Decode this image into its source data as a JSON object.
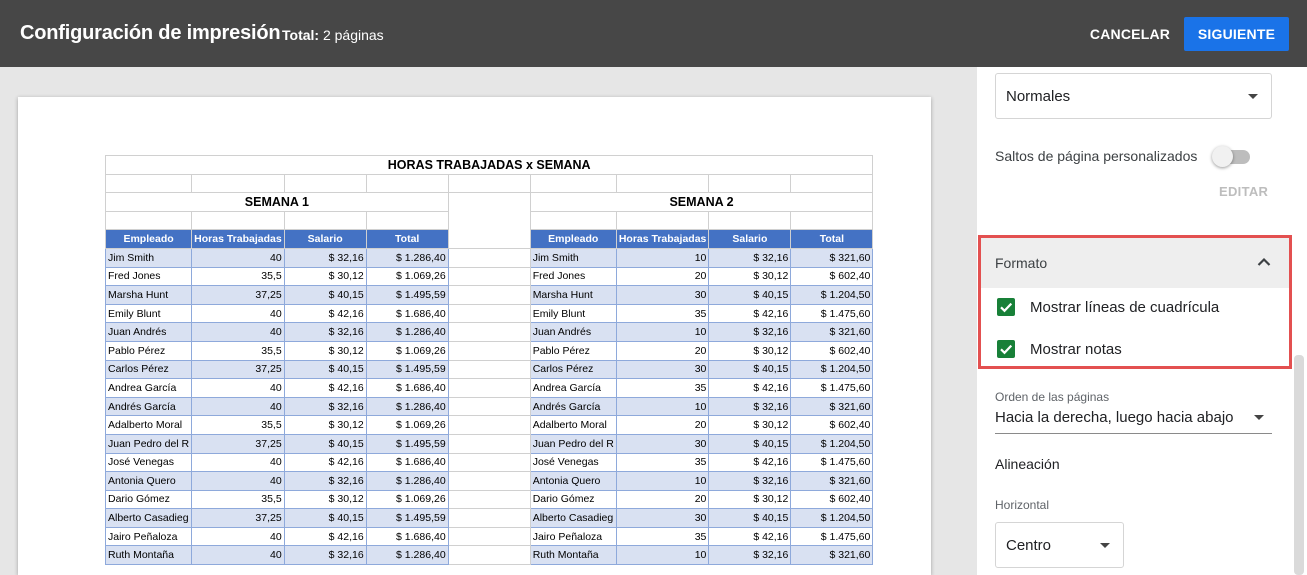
{
  "topbar": {
    "title": "Configuración de impresión",
    "total_label": "Total:",
    "total_value": "2 páginas",
    "cancel": "CANCELAR",
    "next": "SIGUIENTE"
  },
  "sheet": {
    "title": "HORAS TRABAJADAS x SEMANA",
    "week1": "SEMANA 1",
    "week2": "SEMANA 2",
    "headers": [
      "Empleado",
      "Horas Trabajadas",
      "Salario",
      "Total"
    ],
    "week1_rows": [
      [
        "Jim Smith",
        "40",
        "$ 32,16",
        "$ 1.286,40"
      ],
      [
        "Fred Jones",
        "35,5",
        "$ 30,12",
        "$ 1.069,26"
      ],
      [
        "Marsha Hunt",
        "37,25",
        "$ 40,15",
        "$ 1.495,59"
      ],
      [
        "Emily Blunt",
        "40",
        "$ 42,16",
        "$ 1.686,40"
      ],
      [
        "Juan Andrés",
        "40",
        "$ 32,16",
        "$ 1.286,40"
      ],
      [
        "Pablo Pérez",
        "35,5",
        "$ 30,12",
        "$ 1.069,26"
      ],
      [
        "Carlos Pérez",
        "37,25",
        "$ 40,15",
        "$ 1.495,59"
      ],
      [
        "Andrea García",
        "40",
        "$ 42,16",
        "$ 1.686,40"
      ],
      [
        "Andrés García",
        "40",
        "$ 32,16",
        "$ 1.286,40"
      ],
      [
        "Adalberto Moral",
        "35,5",
        "$ 30,12",
        "$ 1.069,26"
      ],
      [
        "Juan Pedro del R",
        "37,25",
        "$ 40,15",
        "$ 1.495,59"
      ],
      [
        "José Venegas",
        "40",
        "$ 42,16",
        "$ 1.686,40"
      ],
      [
        "Antonia Quero",
        "40",
        "$ 32,16",
        "$ 1.286,40"
      ],
      [
        "Dario Gómez",
        "35,5",
        "$ 30,12",
        "$ 1.069,26"
      ],
      [
        "Alberto Casadieg",
        "37,25",
        "$ 40,15",
        "$ 1.495,59"
      ],
      [
        "Jairo Peñaloza",
        "40",
        "$ 42,16",
        "$ 1.686,40"
      ],
      [
        "Ruth Montaña",
        "40",
        "$ 32,16",
        "$ 1.286,40"
      ]
    ],
    "week2_rows": [
      [
        "Jim Smith",
        "10",
        "$ 32,16",
        "$ 321,60"
      ],
      [
        "Fred Jones",
        "20",
        "$ 30,12",
        "$ 602,40"
      ],
      [
        "Marsha Hunt",
        "30",
        "$ 40,15",
        "$ 1.204,50"
      ],
      [
        "Emily Blunt",
        "35",
        "$ 42,16",
        "$ 1.475,60"
      ],
      [
        "Juan Andrés",
        "10",
        "$ 32,16",
        "$ 321,60"
      ],
      [
        "Pablo Pérez",
        "20",
        "$ 30,12",
        "$ 602,40"
      ],
      [
        "Carlos Pérez",
        "30",
        "$ 40,15",
        "$ 1.204,50"
      ],
      [
        "Andrea García",
        "35",
        "$ 42,16",
        "$ 1.475,60"
      ],
      [
        "Andrés García",
        "10",
        "$ 32,16",
        "$ 321,60"
      ],
      [
        "Adalberto Moral",
        "20",
        "$ 30,12",
        "$ 602,40"
      ],
      [
        "Juan Pedro del R",
        "30",
        "$ 40,15",
        "$ 1.204,50"
      ],
      [
        "José Venegas",
        "35",
        "$ 42,16",
        "$ 1.475,60"
      ],
      [
        "Antonia Quero",
        "10",
        "$ 32,16",
        "$ 321,60"
      ],
      [
        "Dario Gómez",
        "20",
        "$ 30,12",
        "$ 602,40"
      ],
      [
        "Alberto Casadieg",
        "30",
        "$ 40,15",
        "$ 1.204,50"
      ],
      [
        "Jairo Peñaloza",
        "35",
        "$ 42,16",
        "$ 1.475,60"
      ],
      [
        "Ruth Montaña",
        "10",
        "$ 32,16",
        "$ 321,60"
      ]
    ]
  },
  "panel": {
    "margins_value": "Normales",
    "custom_breaks_label": "Saltos de página personalizados",
    "custom_breaks_on": false,
    "edit_label": "EDITAR",
    "format_title": "Formato",
    "show_gridlines_label": "Mostrar líneas de cuadrícula",
    "show_gridlines_checked": true,
    "show_notes_label": "Mostrar notas",
    "show_notes_checked": true,
    "page_order_label": "Orden de las páginas",
    "page_order_value": "Hacia la derecha, luego hacia abajo",
    "alignment_label": "Alineación",
    "horizontal_label": "Horizontal",
    "horizontal_value": "Centro"
  },
  "colors": {
    "topbar": "#474747",
    "primary_button": "#1a73e8",
    "table_header": "#4472c4",
    "row_band": "#d9e1f2",
    "checkbox": "#188038",
    "highlight_border": "#e35050"
  }
}
